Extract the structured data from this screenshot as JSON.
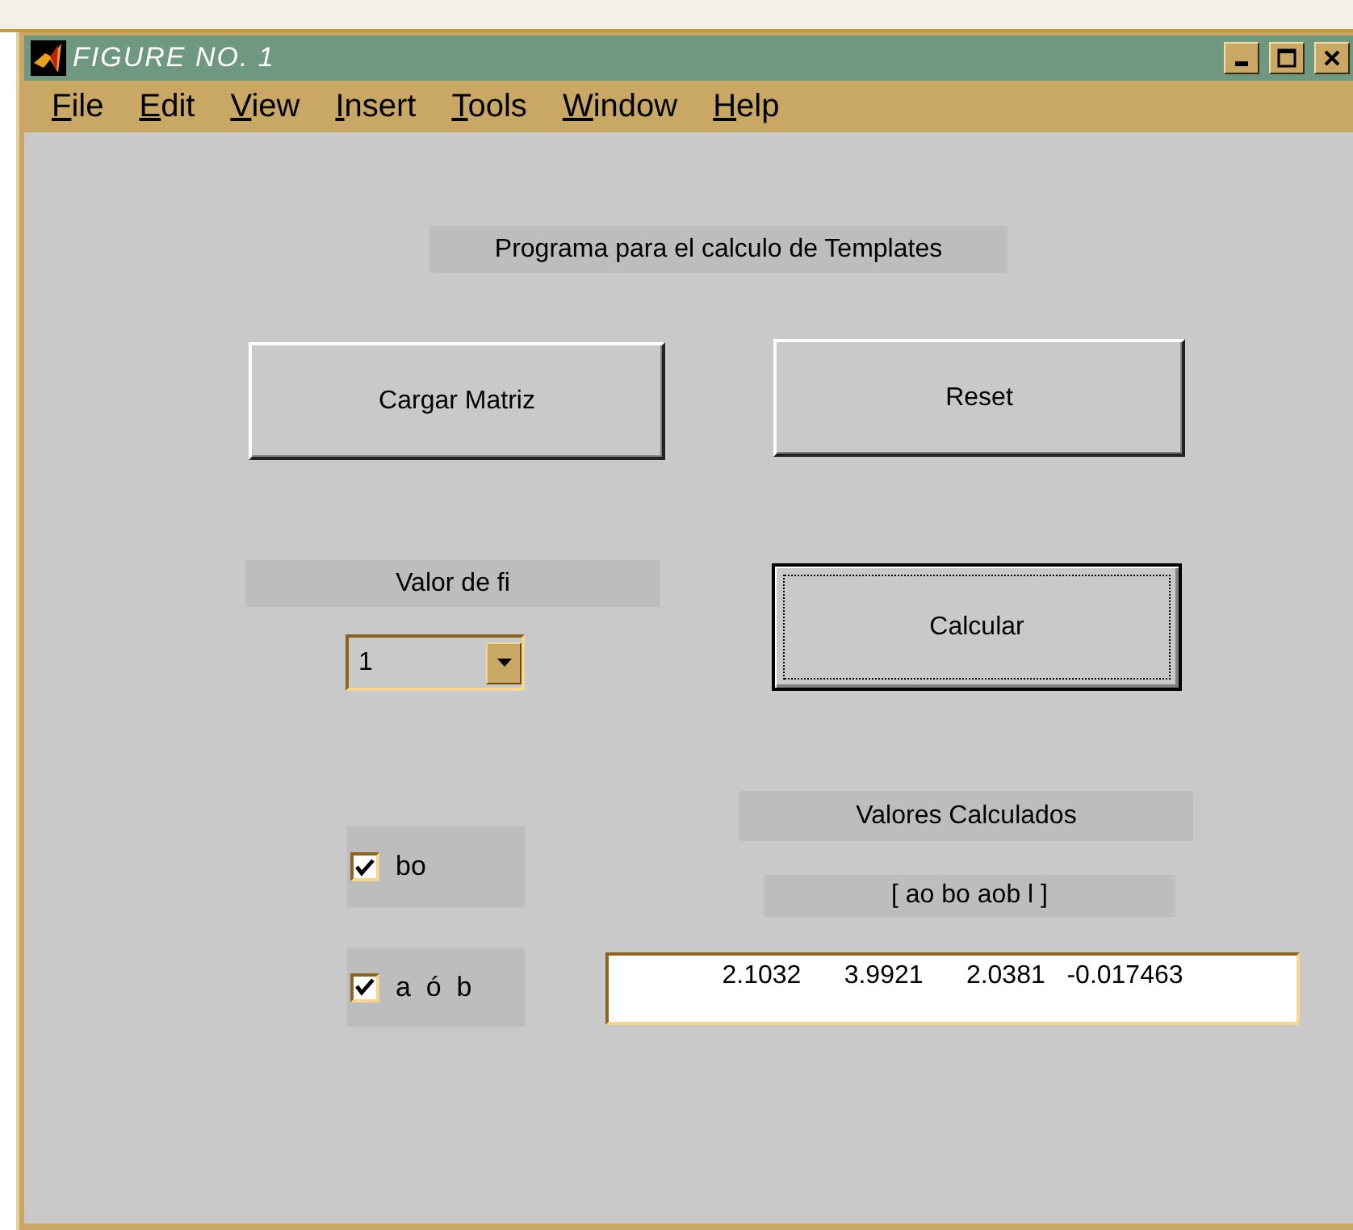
{
  "window": {
    "title": "FIGURE NO. 1"
  },
  "menu": [
    {
      "label": "File"
    },
    {
      "label": "Edit"
    },
    {
      "label": "View"
    },
    {
      "label": "Insert"
    },
    {
      "label": "Tools"
    },
    {
      "label": "Window"
    },
    {
      "label": "Help"
    }
  ],
  "controls": [
    {
      "kind": "label",
      "text": "Programa para el calculo de Templates"
    },
    {
      "kind": "button",
      "text": "Cargar Matriz",
      "focused": false
    },
    {
      "kind": "button",
      "text": "Reset",
      "focused": false
    },
    {
      "kind": "label",
      "text": "Valor de fi"
    },
    {
      "kind": "popup",
      "text": "1"
    },
    {
      "kind": "button",
      "text": "Calcular",
      "focused": true
    },
    {
      "kind": "label",
      "text": "Valores Calculados"
    },
    {
      "kind": "label",
      "text": "[ ao bo aob l ]"
    },
    {
      "kind": "checkbox",
      "text": "bo",
      "checked": true
    },
    {
      "kind": "checkbox",
      "text": "a  ó  b",
      "checked": true
    },
    {
      "kind": "edit",
      "text": "2.1032      3.9921      2.0381   -0.017463"
    }
  ]
}
